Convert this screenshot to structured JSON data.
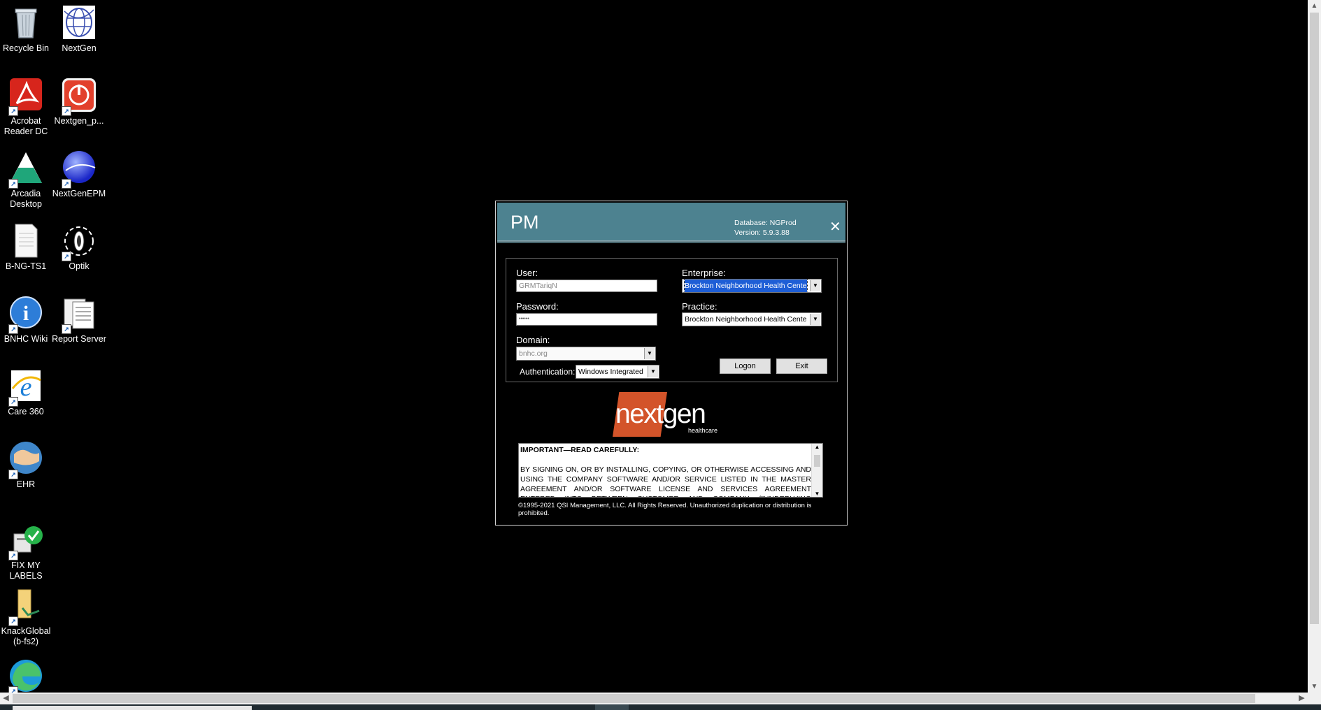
{
  "desktop": {
    "icons": [
      {
        "label": "Recycle Bin"
      },
      {
        "label": "NextGen"
      },
      {
        "label": "Acrobat Reader DC"
      },
      {
        "label": "Nextgen_p..."
      },
      {
        "label": "Arcadia Desktop"
      },
      {
        "label": "NextGenEPM"
      },
      {
        "label": "B-NG-TS1"
      },
      {
        "label": "Optik"
      },
      {
        "label": "BNHC Wiki"
      },
      {
        "label": "Report Server"
      },
      {
        "label": "Care 360"
      },
      {
        "label": "EHR"
      },
      {
        "label": "FIX MY LABELS"
      },
      {
        "label": "KnackGlobal (b-fs2)"
      }
    ]
  },
  "dialog": {
    "title": "PM",
    "database": "Database: NGProd",
    "version": "Version: 5.9.3.88",
    "close_glyph": "✕",
    "user_label": "User:",
    "user_value": "GRMTariqN",
    "password_label": "Password:",
    "password_value": "••••••",
    "domain_label": "Domain:",
    "domain_value": "bnhc.org",
    "authentication_label": "Authentication:",
    "authentication_value": "Windows Integrated",
    "enterprise_label": "Enterprise:",
    "enterprise_value": "Brockton Neighborhood Health Cente",
    "practice_label": "Practice:",
    "practice_value": "Brockton Neighborhood Health Cente",
    "logon_label": "Logon",
    "exit_label": "Exit",
    "logo_text": "nextgen",
    "logo_sub": "healthcare",
    "license_title": "IMPORTANT—READ CAREFULLY:",
    "license_body": "BY SIGNING ON, OR BY INSTALLING, COPYING, OR OTHERWISE ACCESSING AND USING THE COMPANY SOFTWARE AND/OR SERVICE LISTED IN THE MASTER AGREEMENT AND/OR SOFTWARE LICENSE AND SERVICES AGREEMENT ENTERED INTO BETWEEN CUSTOMER AND COMPANY (\"UNDERLYING AGREEMENT\"), YOU",
    "copyright": "©1995-2021 QSI Management, LLC. All Rights Reserved.  Unauthorized duplication or distribution is prohibited."
  }
}
